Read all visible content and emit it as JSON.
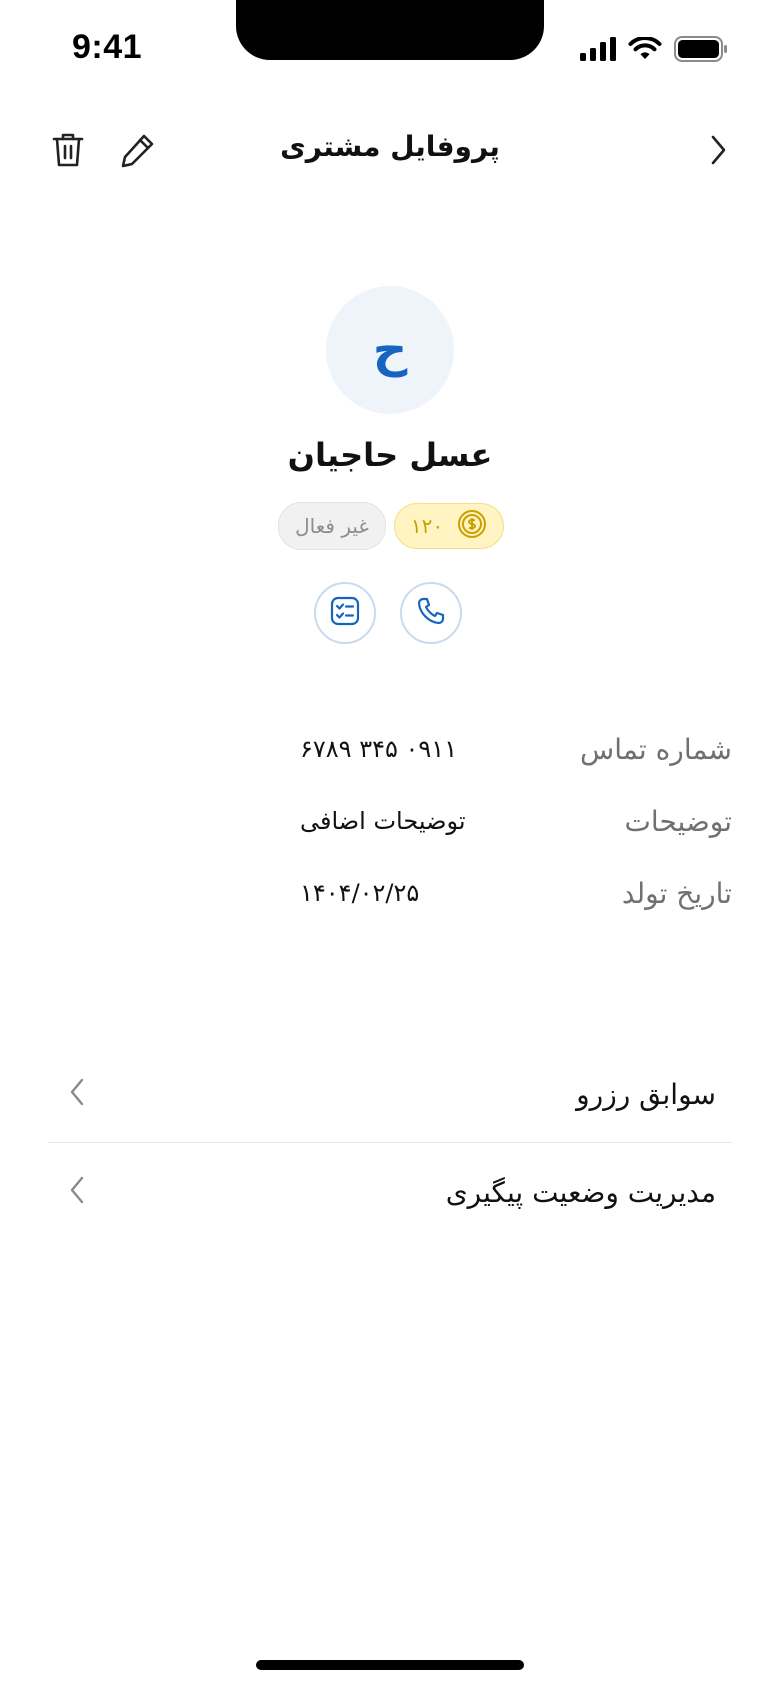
{
  "status_bar": {
    "time": "9:41"
  },
  "header": {
    "title": "پروفایل مشتری",
    "icons": {
      "back": "chevron-right-icon",
      "edit": "pencil-icon",
      "delete": "trash-icon"
    }
  },
  "profile": {
    "avatar_initial": "ح",
    "name": "عسل حاجیان",
    "status_badge": "غیر فعال",
    "points": "۱۲۰"
  },
  "info": [
    {
      "label": "شماره تماس",
      "value": "۰۹۱۱ ۳۴۵ ۶۷۸۹"
    },
    {
      "label": "توضیحات",
      "value": "توضیحات اضافی"
    },
    {
      "label": "تاریخ تولد",
      "value": "۱۴۰۴/۰۲/۲۵"
    }
  ],
  "menu": [
    {
      "label": "سوابق رزرو"
    },
    {
      "label": "مدیریت وضعیت پیگیری"
    }
  ],
  "colors": {
    "accent": "#1565C0",
    "avatar_bg": "#EEF4FA",
    "points_bg": "#FFF4C2",
    "points_fg": "#C8A000",
    "inactive_bg": "#F1F1F1",
    "inactive_fg": "#8D8D8D"
  }
}
